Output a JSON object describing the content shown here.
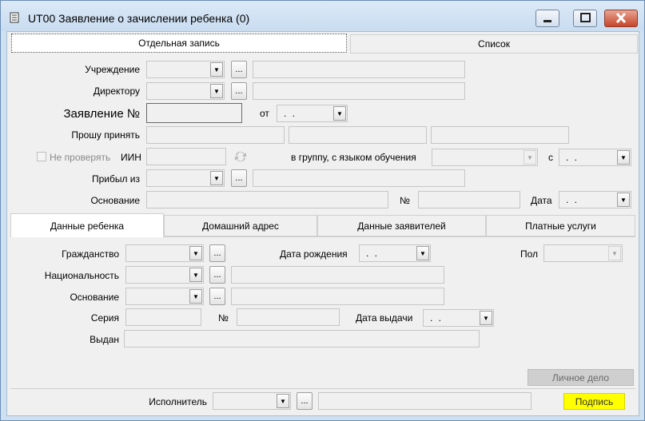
{
  "window": {
    "title": "UT00 Заявление о зачислении ребенка (0)",
    "minimize_icon": "minimize-icon",
    "maximize_icon": "maximize-icon",
    "close_icon": "close-icon"
  },
  "top_tabs": [
    {
      "label": "Отдельная запись",
      "active": true
    },
    {
      "label": "Список",
      "active": false
    }
  ],
  "form": {
    "institution_label": "Учреждение",
    "director_label": "Директору",
    "application_label": "Заявление №",
    "from_label": "от",
    "date_placeholder": ". .",
    "request_label": "Прошу принять",
    "no_check_label": "Не проверять",
    "iin_label": "ИИН",
    "group_label": "в группу, с языком обучения",
    "since_label": "с",
    "arrived_label": "Прибыл из",
    "basis_label": "Основание",
    "number_label": "№",
    "date_label": "Дата",
    "dots": "..."
  },
  "sub_tabs": [
    {
      "label": "Данные ребенка",
      "active": true
    },
    {
      "label": "Домашний адрес",
      "active": false
    },
    {
      "label": "Данные заявителей",
      "active": false
    },
    {
      "label": "Платные услуги",
      "active": false
    }
  ],
  "child": {
    "citizenship_label": "Гражданство",
    "birthdate_label": "Дата рождения",
    "gender_label": "Пол",
    "nationality_label": "Национальность",
    "basis_label": "Основание",
    "series_label": "Серия",
    "number_label": "№",
    "issue_date_label": "Дата выдачи",
    "issued_by_label": "Выдан",
    "personal_file_button": "Личное дело"
  },
  "footer": {
    "executor_label": "Исполнитель",
    "sign_button": "Подпись"
  },
  "colors": {
    "sign_button_bg": "#ffff00",
    "window_frame": "#cfe0f1",
    "close_button": "#c7452a"
  }
}
